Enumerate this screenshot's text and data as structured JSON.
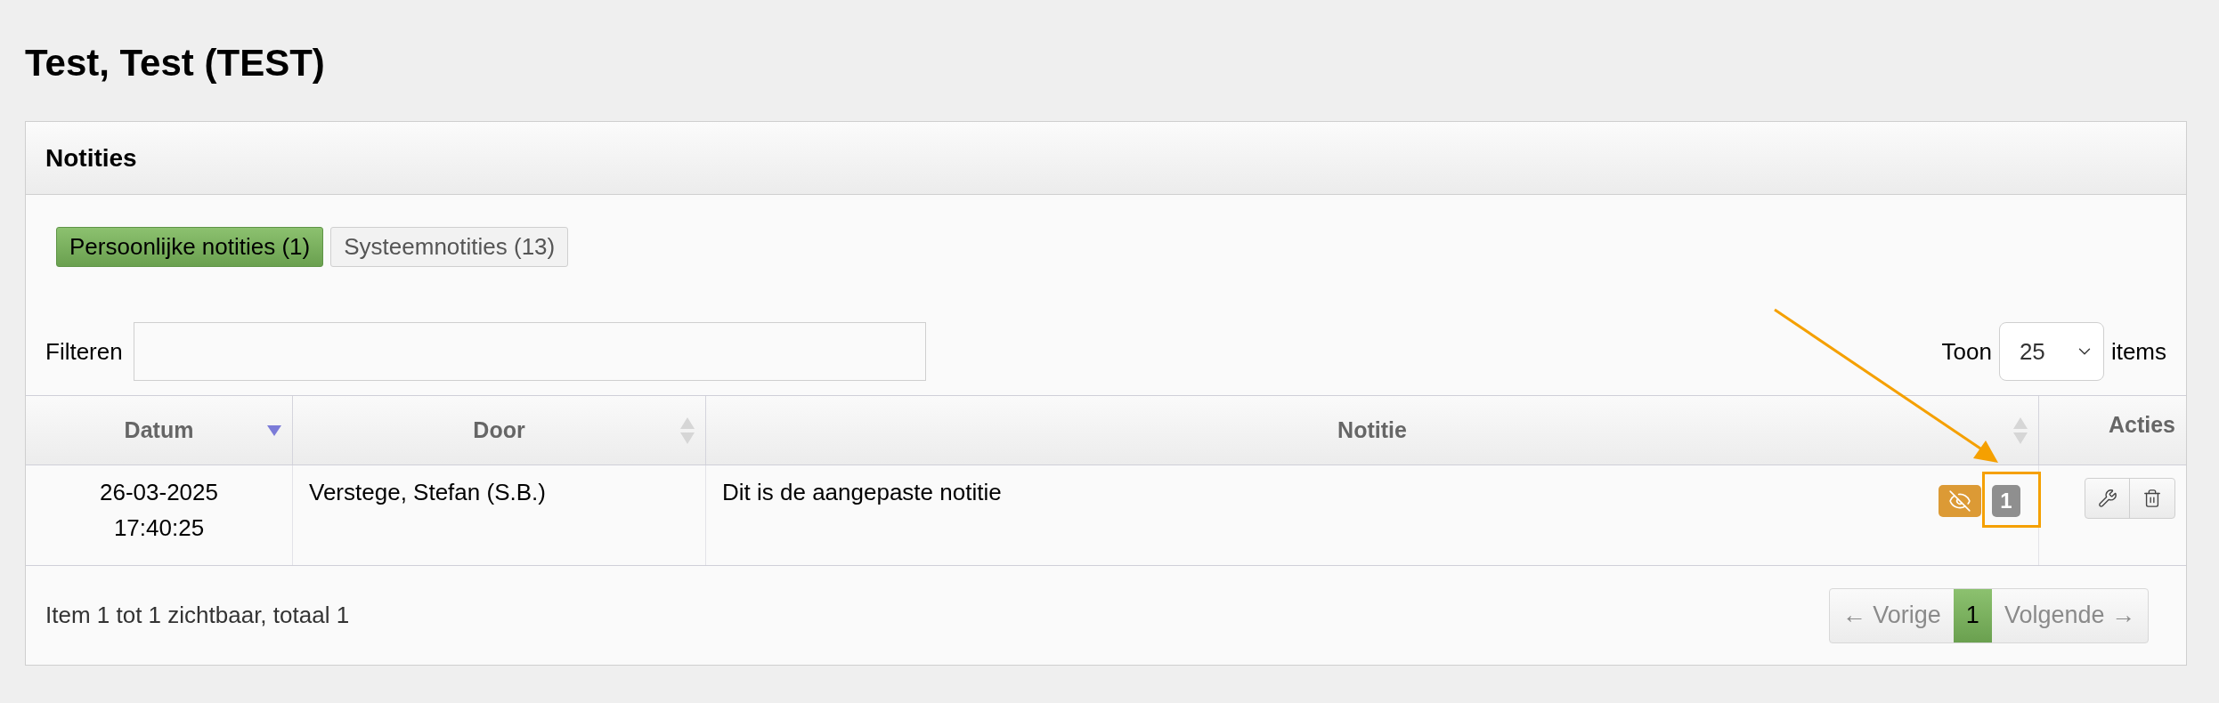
{
  "page_title": "Test, Test (TEST)",
  "panel": {
    "title": "Notities",
    "tabs": [
      {
        "label": "Persoonlijke notities (1)",
        "selected": true
      },
      {
        "label": "Systeemnotities (13)",
        "selected": false
      }
    ],
    "filter": {
      "label": "Filteren"
    },
    "page_size": {
      "label_before": "Toon",
      "value": "25",
      "label_after": "items"
    },
    "table": {
      "columns": [
        {
          "label": "Datum",
          "sortable": true,
          "sorted": true
        },
        {
          "label": "Door",
          "sortable": true,
          "sorted": false
        },
        {
          "label": "Notitie",
          "sortable": true,
          "sorted": false
        },
        {
          "label": "Acties",
          "sortable": false
        }
      ],
      "rows": [
        {
          "datum": "26-03-2025\n17:40:25",
          "door": "Verstege, Stefan (S.B.)",
          "notitie": "Dit is de aangepaste notitie",
          "hidden": true,
          "count": "1"
        }
      ]
    },
    "footer": {
      "summary": "Item 1 tot 1 zichtbaar, totaal 1",
      "pagination": [
        {
          "label": "← Vorige",
          "selected": false,
          "disabled": true
        },
        {
          "label": "1",
          "selected": true
        },
        {
          "label": "Volgende →",
          "selected": false,
          "disabled": true
        }
      ]
    }
  }
}
